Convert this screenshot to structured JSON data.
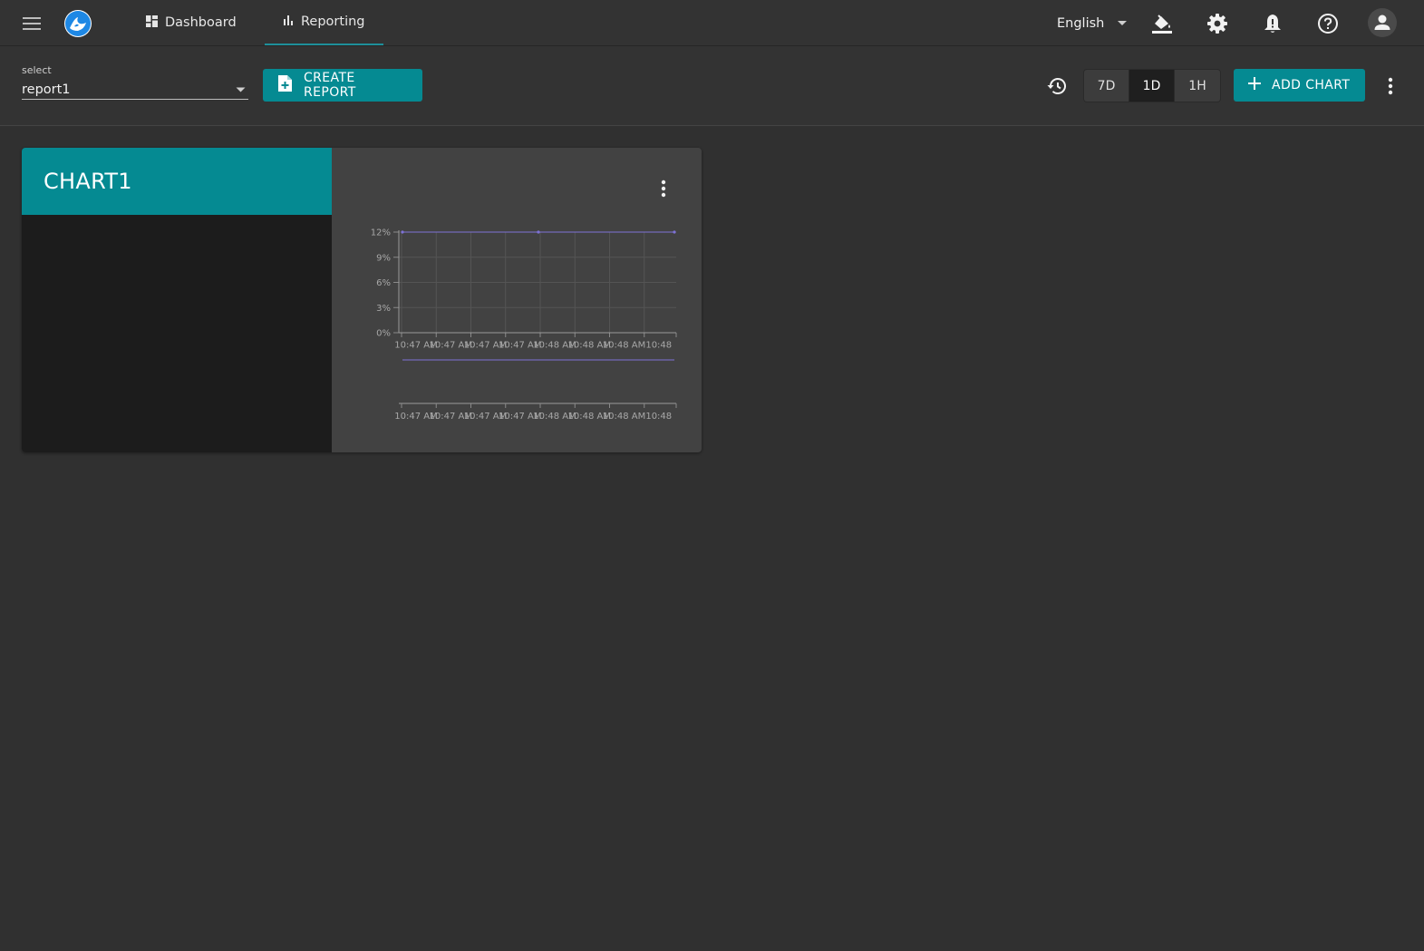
{
  "header": {
    "nav": [
      {
        "label": "Dashboard",
        "icon": "dashboard-icon"
      },
      {
        "label": "Reporting",
        "icon": "bar-chart-icon",
        "active": true
      }
    ],
    "language": "English",
    "icons": [
      "menu-icon",
      "app-logo",
      "paint-bucket-icon",
      "gear-icon",
      "bell-alert-icon",
      "help-icon",
      "account-icon"
    ]
  },
  "toolbar": {
    "select_label": "select",
    "select_value": "report1",
    "create_report_label": "CREATE REPORT",
    "ranges": [
      "7D",
      "1D",
      "1H"
    ],
    "active_range": "1D",
    "add_chart_label": "ADD CHART"
  },
  "card": {
    "title": "CHART1"
  },
  "colors": {
    "accent": "#058a92",
    "series": "#7e72d6",
    "background": "#303030"
  },
  "chart_data": [
    {
      "type": "line",
      "ylim": [
        0,
        12
      ],
      "yticks": [
        "0%",
        "3%",
        "6%",
        "9%",
        "12%"
      ],
      "xticks": [
        "10:47 AM",
        "10:47 AM",
        "10:47 AM",
        "10:47 AM",
        "10:48 AM",
        "10:48 AM",
        "10:48 AM",
        "10:48"
      ],
      "series": [
        {
          "values": [
            12,
            12,
            12
          ]
        }
      ],
      "grid": true
    },
    {
      "type": "line",
      "xticks": [
        "10:47 AM",
        "10:47 AM",
        "10:47 AM",
        "10:47 AM",
        "10:48 AM",
        "10:48 AM",
        "10:48 AM",
        "10:48"
      ],
      "series": [
        {
          "values": [
            1,
            1
          ]
        }
      ],
      "grid": false
    }
  ]
}
